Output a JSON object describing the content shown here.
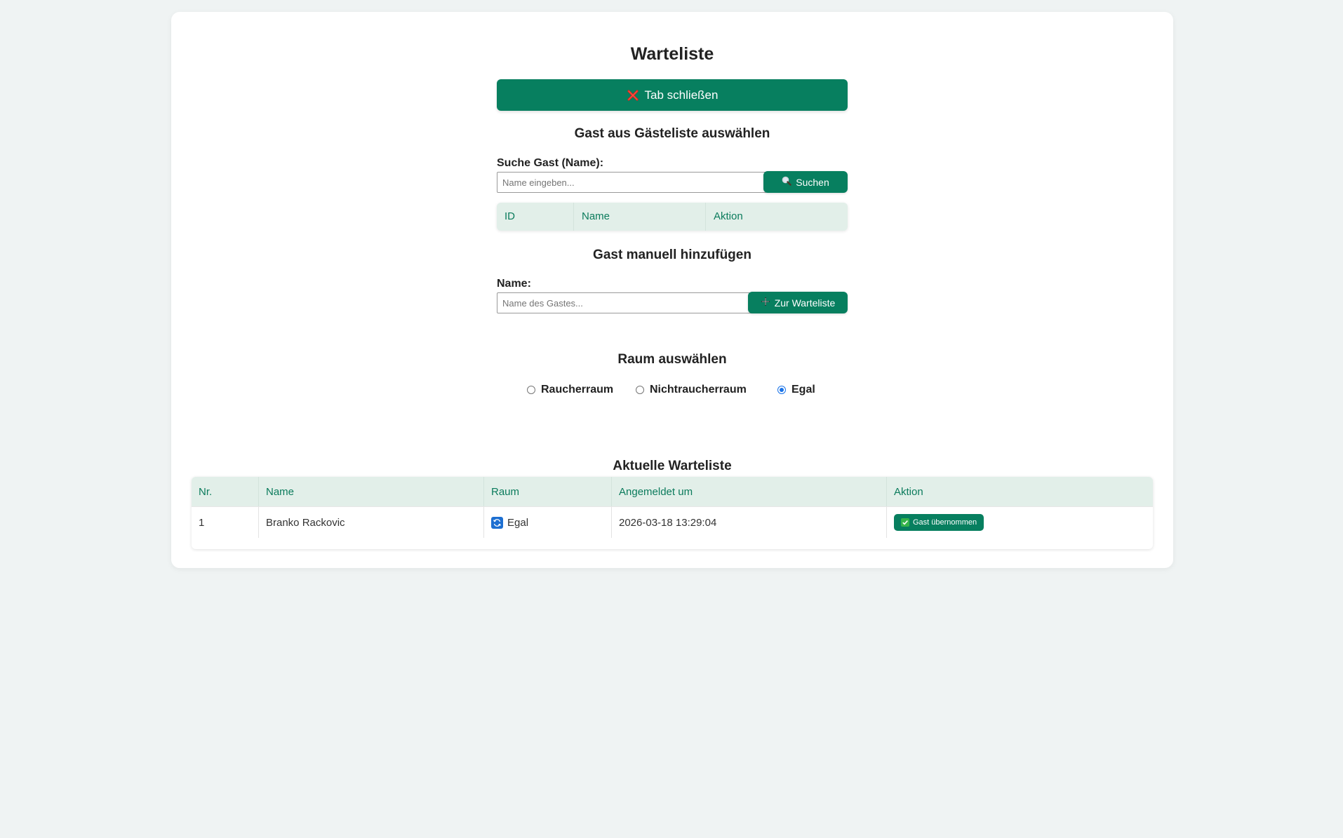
{
  "page": {
    "title": "Warteliste",
    "close_button_label": "Tab schließen"
  },
  "guest_select": {
    "heading": "Gast aus Gästeliste auswählen",
    "search_label": "Suche Gast (Name):",
    "search_placeholder": "Name eingeben...",
    "search_value": "",
    "search_button_label": "Suchen",
    "table_headers": [
      "ID",
      "Name",
      "Aktion"
    ]
  },
  "manual_add": {
    "heading": "Gast manuell hinzufügen",
    "name_label": "Name:",
    "name_placeholder": "Name des Gastes...",
    "name_value": "",
    "add_button_label": "Zur Warteliste"
  },
  "room": {
    "heading": "Raum auswählen",
    "options": [
      {
        "label": "Raucherraum",
        "checked": false
      },
      {
        "label": "Nichtraucherraum",
        "checked": false
      },
      {
        "label": "Egal",
        "checked": true
      }
    ]
  },
  "waitlist": {
    "heading": "Aktuelle Warteliste",
    "headers": [
      "Nr.",
      "Name",
      "Raum",
      "Angemeldet um",
      "Aktion"
    ],
    "rows": [
      {
        "nr": "1",
        "name": "Branko Rackovic",
        "room": "Egal",
        "room_icon": "refresh-icon",
        "registered": "2026-03-18 13:29:04",
        "action_label": "Gast übernommen",
        "action_icon": "checkmark-icon"
      }
    ]
  },
  "colors": {
    "accent": "#077f5f",
    "header_bg": "#e2efe9",
    "header_text": "#0b7b5c",
    "page_bg": "#eff3f3"
  }
}
